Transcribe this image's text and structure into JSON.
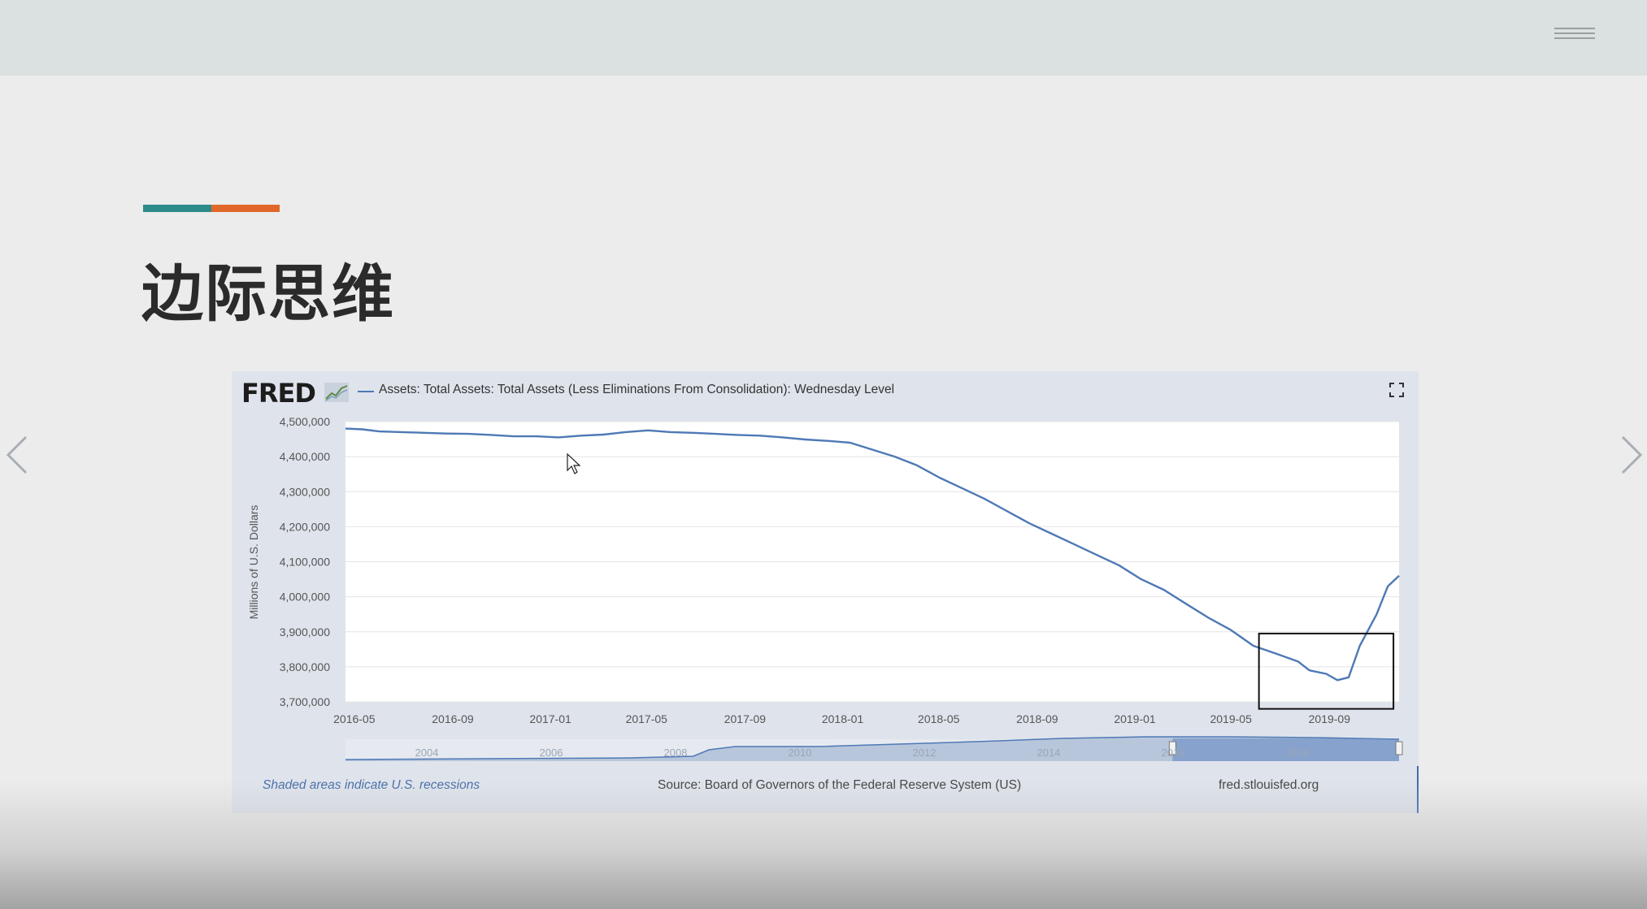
{
  "slide": {
    "title": "边际思维",
    "accent_colors": [
      "#2b8a8a",
      "#e2672a"
    ]
  },
  "nav": {
    "prev_icon": "chevron-left-icon",
    "next_icon": "chevron-right-icon",
    "menu_icon": "hamburger-menu-icon"
  },
  "chart_panel": {
    "logo": "FRED",
    "legend": "Assets: Total Assets: Total Assets (Less Eliminations From Consolidation): Wednesday Level",
    "footer": {
      "recession_note": "Shaded areas indicate U.S. recessions",
      "source": "Source: Board of Governors of the Federal Reserve System (US)",
      "site": "fred.stlouisfed.org"
    },
    "navigator_years": [
      "2004",
      "2006",
      "2008",
      "2010",
      "2012",
      "2014",
      "2016",
      "2018"
    ]
  },
  "chart_data": {
    "type": "line",
    "ylabel": "Millions of U.S. Dollars",
    "xlabel": "",
    "line_color": "#4e79b5",
    "ylim": [
      3700000,
      4500000
    ],
    "y_ticks": [
      "4,500,000",
      "4,400,000",
      "4,300,000",
      "4,200,000",
      "4,100,000",
      "4,000,000",
      "3,900,000",
      "3,800,000",
      "3,700,000"
    ],
    "x_ticks": [
      "2016-05",
      "2016-09",
      "2017-01",
      "2017-05",
      "2017-09",
      "2018-01",
      "2018-05",
      "2018-09",
      "2019-01",
      "2019-05",
      "2019-09"
    ],
    "xlim": [
      "2016-04-20",
      "2019-11-27"
    ],
    "grid": true,
    "highlight_box": {
      "x_start": "2019-06-05",
      "x_end": "2019-11-20",
      "y_min": 3680000,
      "y_max": 3895000
    },
    "series": [
      {
        "x": [
          "2016-04-20",
          "2016-05-11",
          "2016-06-01",
          "2016-06-29",
          "2016-07-27",
          "2016-08-24",
          "2016-09-21",
          "2016-10-19",
          "2016-11-16",
          "2016-12-14",
          "2017-01-11",
          "2017-02-08",
          "2017-03-08",
          "2017-04-05",
          "2017-05-03",
          "2017-05-31",
          "2017-06-28",
          "2017-07-26",
          "2017-08-23",
          "2017-09-20",
          "2017-10-18",
          "2017-11-15",
          "2017-12-13",
          "2018-01-10",
          "2018-02-07",
          "2018-03-07",
          "2018-04-04",
          "2018-05-02",
          "2018-05-30",
          "2018-06-27",
          "2018-07-25",
          "2018-08-22",
          "2018-09-19",
          "2018-10-17",
          "2018-11-14",
          "2018-12-12",
          "2019-01-09",
          "2019-02-06",
          "2019-03-06",
          "2019-04-03",
          "2019-05-01",
          "2019-05-29",
          "2019-06-26",
          "2019-07-24",
          "2019-08-07",
          "2019-08-28",
          "2019-09-11",
          "2019-09-25",
          "2019-10-09",
          "2019-10-30",
          "2019-11-13",
          "2019-11-27"
        ],
        "y": [
          4480000,
          4478000,
          4472000,
          4470000,
          4468000,
          4466000,
          4465000,
          4462000,
          4458000,
          4458000,
          4455000,
          4460000,
          4463000,
          4470000,
          4475000,
          4470000,
          4468000,
          4465000,
          4462000,
          4460000,
          4455000,
          4449000,
          4445000,
          4440000,
          4420000,
          4400000,
          4375000,
          4340000,
          4310000,
          4280000,
          4245000,
          4210000,
          4180000,
          4150000,
          4120000,
          4090000,
          4050000,
          4020000,
          3980000,
          3940000,
          3905000,
          3860000,
          3838000,
          3815000,
          3790000,
          3780000,
          3762000,
          3770000,
          3860000,
          3950000,
          4030000,
          4060000
        ]
      }
    ]
  }
}
